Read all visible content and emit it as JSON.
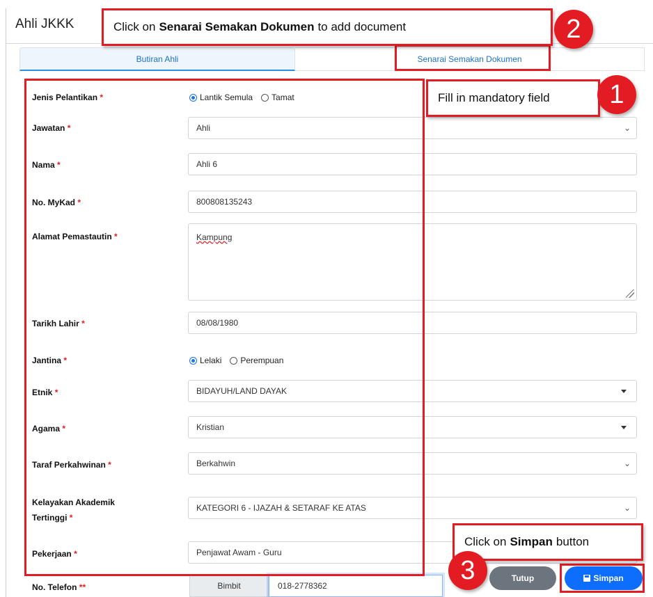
{
  "modal": {
    "title": "Ahli JKKK"
  },
  "tabs": [
    {
      "label": "Butiran Ahli",
      "active": true
    },
    {
      "label": "Senarai Semakan Dokumen",
      "active": false
    }
  ],
  "form": {
    "jenis_pelantikan": {
      "label": "Jenis Pelantikan",
      "options": [
        "Lantik Semula",
        "Tamat"
      ],
      "selected": "Lantik Semula"
    },
    "jawatan": {
      "label": "Jawatan",
      "value": "Ahli"
    },
    "nama": {
      "label": "Nama",
      "value": "Ahli 6"
    },
    "mykad": {
      "label": "No. MyKad",
      "value": "800808135243"
    },
    "alamat": {
      "label": "Alamat Pemastautin",
      "value": "Kampung"
    },
    "tarikh_lahir": {
      "label": "Tarikh Lahir",
      "value": "08/08/1980"
    },
    "jantina": {
      "label": "Jantina",
      "options": [
        "Lelaki",
        "Perempuan"
      ],
      "selected": "Lelaki"
    },
    "etnik": {
      "label": "Etnik",
      "value": "BIDAYUH/LAND DAYAK"
    },
    "agama": {
      "label": "Agama",
      "value": "Kristian"
    },
    "taraf": {
      "label": "Taraf Perkahwinan",
      "value": "Berkahwin"
    },
    "kelayakan": {
      "label_line1": "Kelayakan Akademik",
      "label_line2": "Tertinggi",
      "value": "KATEGORI 6 - IJAZAH & SETARAF KE ATAS"
    },
    "pekerjaan": {
      "label": "Pekerjaan",
      "value": "Penjawat Awam - Guru"
    },
    "telefon": {
      "label": "No. Telefon",
      "required_marker": "**",
      "addon": "Bimbit",
      "value": "018-2778362"
    },
    "required_marker": "*"
  },
  "buttons": {
    "tutup": "Tutup",
    "simpan": "Simpan"
  },
  "annotations": {
    "step1": {
      "number": "1",
      "text": "Fill in mandatory field"
    },
    "step2": {
      "number": "2",
      "text_pre": "Click on ",
      "text_bold": "Senarai Semakan Dokumen",
      "text_post": " to add document"
    },
    "step3": {
      "number": "3",
      "text_pre": "Click on ",
      "text_bold": "Simpan",
      "text_post": " button"
    }
  },
  "colors": {
    "annotation_red": "#e31b23",
    "primary": "#0d6efd",
    "secondary": "#6c757d",
    "link": "#1a73c8"
  },
  "icons": {
    "save": "floppy-disk-icon",
    "select_caret": "caret-down-icon",
    "select_chevron": "chevron-down-icon"
  }
}
